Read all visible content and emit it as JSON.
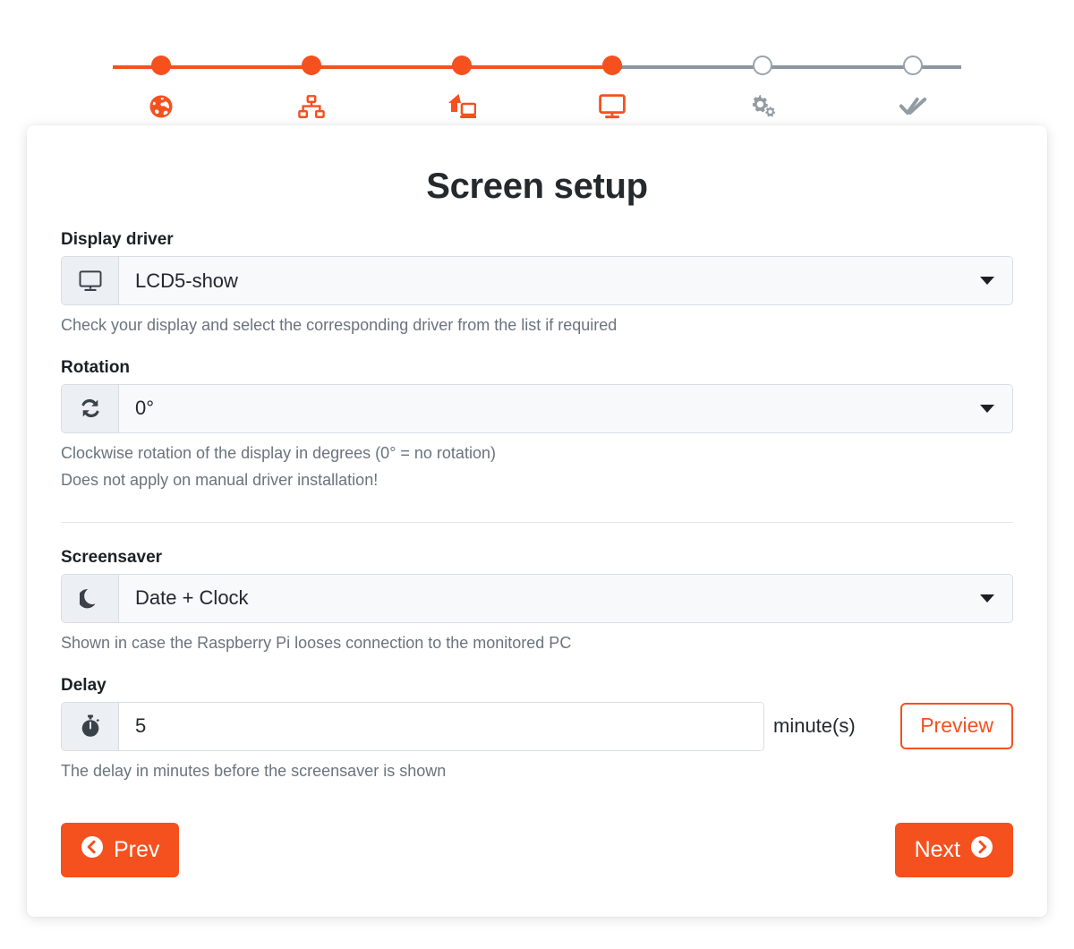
{
  "theme": {
    "accent": "#F4511E",
    "inactive": "#9AA3AB",
    "text_dark": "#24292E",
    "text_muted": "#6A737D",
    "addon_bg": "#ECEFF3",
    "select_bg": "#F7F9FB"
  },
  "stepper": {
    "steps": [
      {
        "icon": "globe-icon",
        "state": "done"
      },
      {
        "icon": "network-sitemap-icon",
        "state": "done"
      },
      {
        "icon": "home-computer-icon",
        "state": "done"
      },
      {
        "icon": "desktop-monitor-icon",
        "state": "done"
      },
      {
        "icon": "cogs-icon",
        "state": "todo"
      },
      {
        "icon": "double-check-icon",
        "state": "todo"
      }
    ]
  },
  "card": {
    "title": "Screen setup",
    "display_driver": {
      "label": "Display driver",
      "icon": "desktop-monitor-icon",
      "value": "LCD5-show",
      "help": "Check your display and select the corresponding driver from the list if required"
    },
    "rotation": {
      "label": "Rotation",
      "icon": "rotate-sync-icon",
      "value": "0°",
      "help_line1": "Clockwise rotation of the display in degrees (0° = no rotation)",
      "help_line2": "Does not apply on manual driver installation!"
    },
    "screensaver": {
      "label": "Screensaver",
      "icon": "moon-icon",
      "value": "Date + Clock",
      "help": "Shown in case the Raspberry Pi looses connection to the monitored PC"
    },
    "delay": {
      "label": "Delay",
      "icon": "stopwatch-icon",
      "value": "5",
      "unit": "minute(s)",
      "preview_label": "Preview",
      "help": "The delay in minutes before the screensaver is shown"
    },
    "nav": {
      "prev_label": "Prev",
      "next_label": "Next",
      "prev_icon": "chevron-left-circle-icon",
      "next_icon": "chevron-right-circle-icon"
    }
  }
}
